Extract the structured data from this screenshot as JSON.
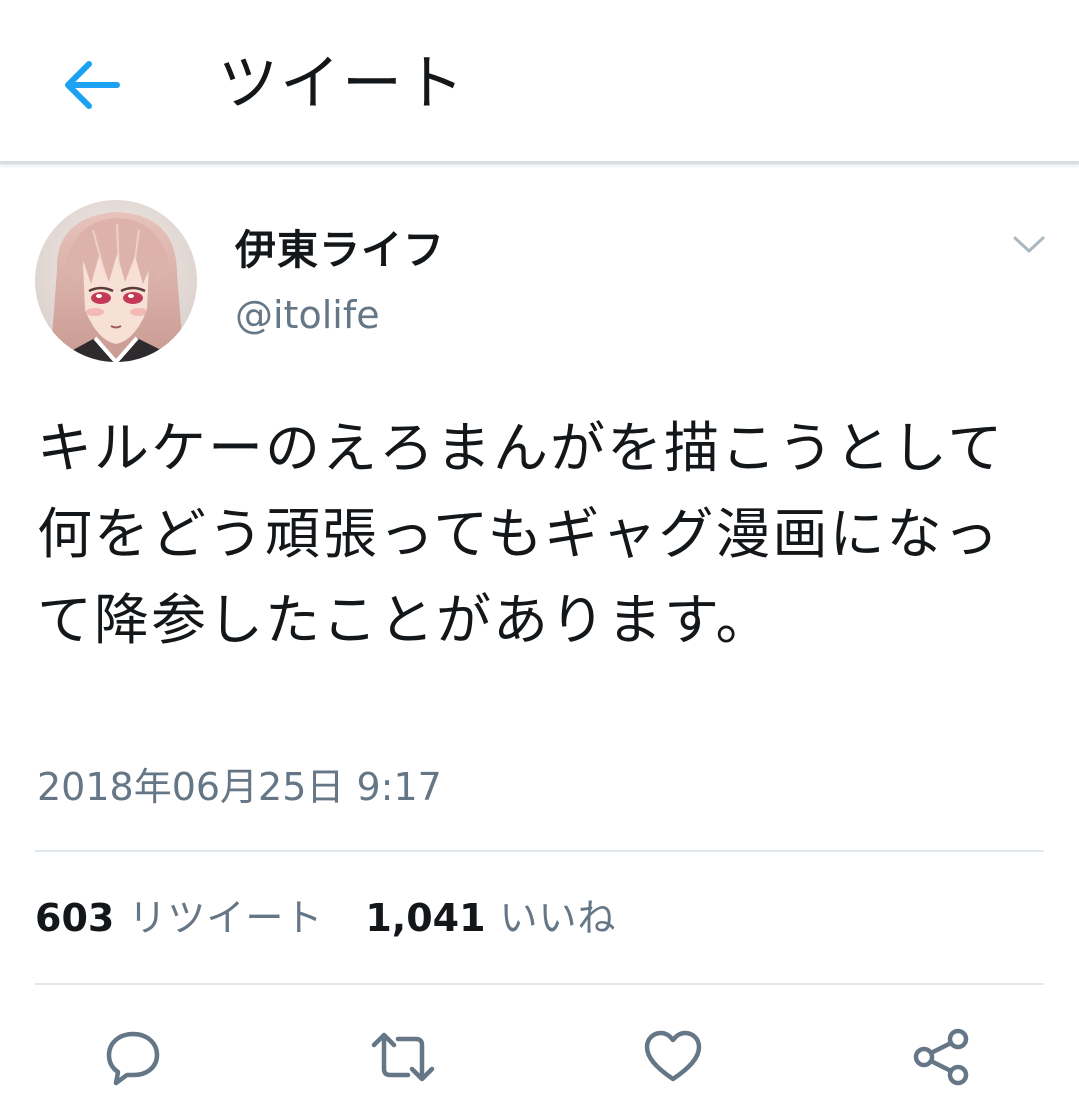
{
  "header": {
    "title": "ツイート",
    "back_icon": "arrow-left-icon"
  },
  "author": {
    "display_name": "伊東ライフ",
    "handle": "@itolife",
    "avatar_icon": "user-avatar"
  },
  "tweet": {
    "text": "キルケーのえろまんがを描こうとして何をどう頑張ってもギャグ漫画になって降参したことがあります。",
    "timestamp": "2018年06月25日 9:17"
  },
  "stats": {
    "retweet_count": "603",
    "retweet_label": "リツイート",
    "like_count": "1,041",
    "like_label": "いいね"
  },
  "actions": [
    "reply-icon",
    "retweet-icon",
    "like-icon",
    "share-icon"
  ],
  "colors": {
    "accent": "#1da1f2",
    "text_primary": "#14171a",
    "text_secondary": "#657786",
    "divider": "#e1e8ed"
  }
}
